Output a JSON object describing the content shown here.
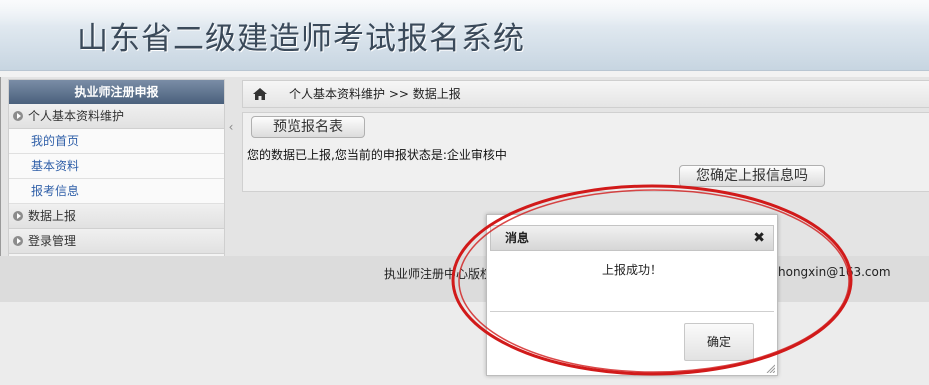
{
  "header": {
    "title": "山东省二级建造师考试报名系统"
  },
  "sidebar": {
    "title": "执业师注册申报",
    "groups": [
      {
        "label": "个人基本资料维护",
        "items": [
          {
            "label": "我的首页"
          },
          {
            "label": "基本资料"
          },
          {
            "label": "报考信息"
          }
        ]
      },
      {
        "label": "数据上报"
      },
      {
        "label": "登录管理"
      }
    ],
    "collapse_icon": "‹"
  },
  "breadcrumb": {
    "home_icon": "home-icon",
    "text": "个人基本资料维护 >> 数据上报"
  },
  "panel": {
    "preview_button": "预览报名表",
    "status_text": "您的数据已上报,您当前的申报状态是:企业审核中",
    "confirm_button": "您确定上报信息吗"
  },
  "footer": {
    "left_text": "执业师注册中心版权",
    "right_text": "hongxin@163.com"
  },
  "dialog": {
    "title": "消息",
    "close_icon": "✖",
    "message": "上报成功！",
    "ok_button": "确定"
  },
  "colors": {
    "annotation": "#d11a1a",
    "sidebar_header": "#4a607c",
    "link": "#2f5fa8"
  }
}
